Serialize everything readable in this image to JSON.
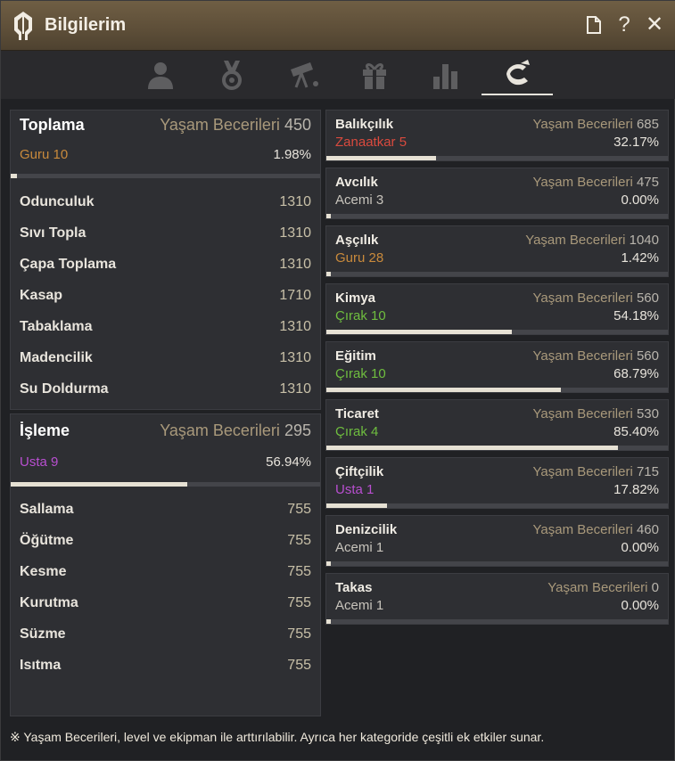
{
  "window": {
    "title": "Bilgilerim"
  },
  "icons": {
    "logo": "helmet-icon",
    "actions": [
      "document-icon",
      "help-icon",
      "close-icon"
    ],
    "tabs": [
      "person-icon",
      "medal-icon",
      "telescope-icon",
      "gift-icon",
      "bar-chart-icon",
      "fish-icon"
    ]
  },
  "title_actions": {
    "help": "?",
    "close": "✕"
  },
  "colors": {
    "zanaatkar": "#d94a3e",
    "acemi": "#c8c4bc",
    "guru": "#c98a3c",
    "cirak": "#6fbe3f",
    "usta": "#b84fd0",
    "label_gold": "#a9997b"
  },
  "gathering": {
    "title": "Toplama",
    "life_label": "Yaşam Becerileri",
    "life_value": "450",
    "rank_label": "Guru",
    "rank_level": "10",
    "rank_color": "#c98a3c",
    "percent": "1.98%",
    "progress": 0.0198,
    "skills": [
      {
        "name": "Odunculuk",
        "value": "1310"
      },
      {
        "name": "Sıvı Topla",
        "value": "1310"
      },
      {
        "name": "Çapa Toplama",
        "value": "1310"
      },
      {
        "name": "Kasap",
        "value": "1710"
      },
      {
        "name": "Tabaklama",
        "value": "1310"
      },
      {
        "name": "Madencilik",
        "value": "1310"
      },
      {
        "name": "Su Doldurma",
        "value": "1310"
      }
    ]
  },
  "processing": {
    "title": "İşleme",
    "life_label": "Yaşam Becerileri",
    "life_value": "295",
    "rank_label": "Usta",
    "rank_level": "9",
    "rank_color": "#b84fd0",
    "percent": "56.94%",
    "progress": 0.5694,
    "skills": [
      {
        "name": "Sallama",
        "value": "755"
      },
      {
        "name": "Öğütme",
        "value": "755"
      },
      {
        "name": "Kesme",
        "value": "755"
      },
      {
        "name": "Kurutma",
        "value": "755"
      },
      {
        "name": "Süzme",
        "value": "755"
      },
      {
        "name": "Isıtma",
        "value": "755"
      }
    ]
  },
  "life_skills": [
    {
      "name": "Balıkçılık",
      "life_label": "Yaşam Becerileri",
      "life_value": "685",
      "rank_label": "Zanaatkar",
      "rank_level": "5",
      "rank_color": "#d94a3e",
      "percent": "32.17%",
      "progress": 0.3217
    },
    {
      "name": "Avcılık",
      "life_label": "Yaşam Becerileri",
      "life_value": "475",
      "rank_label": "Acemi",
      "rank_level": "3",
      "rank_color": "#c8c4bc",
      "percent": "0.00%",
      "progress": 0.0
    },
    {
      "name": "Aşçılık",
      "life_label": "Yaşam Becerileri",
      "life_value": "1040",
      "rank_label": "Guru",
      "rank_level": "28",
      "rank_color": "#c98a3c",
      "percent": "1.42%",
      "progress": 0.0142
    },
    {
      "name": "Kimya",
      "life_label": "Yaşam Becerileri",
      "life_value": "560",
      "rank_label": "Çırak",
      "rank_level": "10",
      "rank_color": "#6fbe3f",
      "percent": "54.18%",
      "progress": 0.5418
    },
    {
      "name": "Eğitim",
      "life_label": "Yaşam Becerileri",
      "life_value": "560",
      "rank_label": "Çırak",
      "rank_level": "10",
      "rank_color": "#6fbe3f",
      "percent": "68.79%",
      "progress": 0.6879
    },
    {
      "name": "Ticaret",
      "life_label": "Yaşam Becerileri",
      "life_value": "530",
      "rank_label": "Çırak",
      "rank_level": "4",
      "rank_color": "#6fbe3f",
      "percent": "85.40%",
      "progress": 0.854
    },
    {
      "name": "Çiftçilik",
      "life_label": "Yaşam Becerileri",
      "life_value": "715",
      "rank_label": "Usta",
      "rank_level": "1",
      "rank_color": "#b84fd0",
      "percent": "17.82%",
      "progress": 0.1782
    },
    {
      "name": "Denizcilik",
      "life_label": "Yaşam Becerileri",
      "life_value": "460",
      "rank_label": "Acemi",
      "rank_level": "1",
      "rank_color": "#c8c4bc",
      "percent": "0.00%",
      "progress": 0.0
    },
    {
      "name": "Takas",
      "life_label": "Yaşam Becerileri",
      "life_value": "0",
      "rank_label": "Acemi",
      "rank_level": "1",
      "rank_color": "#c8c4bc",
      "percent": "0.00%",
      "progress": 0.0
    }
  ],
  "footer": {
    "text": "※ Yaşam Becerileri, level ve ekipman ile arttırılabilir. Ayrıca her kategoride çeşitli ek etkiler sunar."
  }
}
